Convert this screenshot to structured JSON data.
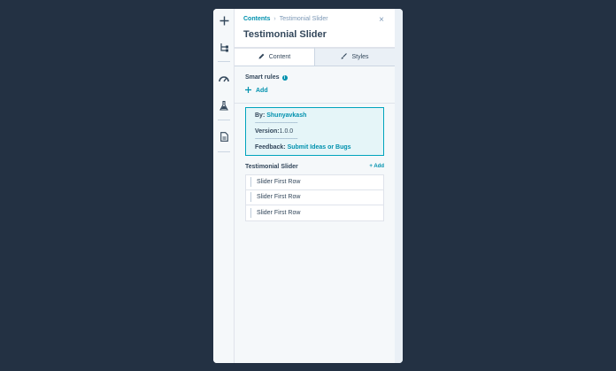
{
  "rail": {
    "icons": [
      "plus-icon",
      "tree-icon",
      "gauge-icon",
      "flask-icon",
      "document-icon"
    ]
  },
  "header": {
    "breadcrumb_root": "Contents",
    "breadcrumb_sep": "›",
    "breadcrumb_current": "Testimonial Slider",
    "close_glyph": "×",
    "title": "Testimonial Slider"
  },
  "tabs": [
    {
      "label": "Content",
      "icon": "pencil-icon",
      "active": true
    },
    {
      "label": "Styles",
      "icon": "brush-icon",
      "active": false
    }
  ],
  "smart_rules": {
    "label": "Smart rules",
    "info_glyph": "i",
    "add_label": "Add"
  },
  "info_box": {
    "by_label": "By:",
    "by_value": "Shunyavkash",
    "dashes": "--------------------------------",
    "version_label": "Version:",
    "version_value": "1.0.0",
    "feedback_label": "Feedback:",
    "feedback_value": "Submit Ideas or Bugs"
  },
  "testimonial": {
    "title": "Testimonial Slider",
    "add_label": "+ Add",
    "rows": [
      "Slider First Row",
      "Slider First Row",
      "Slider First Row"
    ]
  },
  "colors": {
    "background": "#233143",
    "accent": "#0091ae",
    "text": "#33475b"
  }
}
